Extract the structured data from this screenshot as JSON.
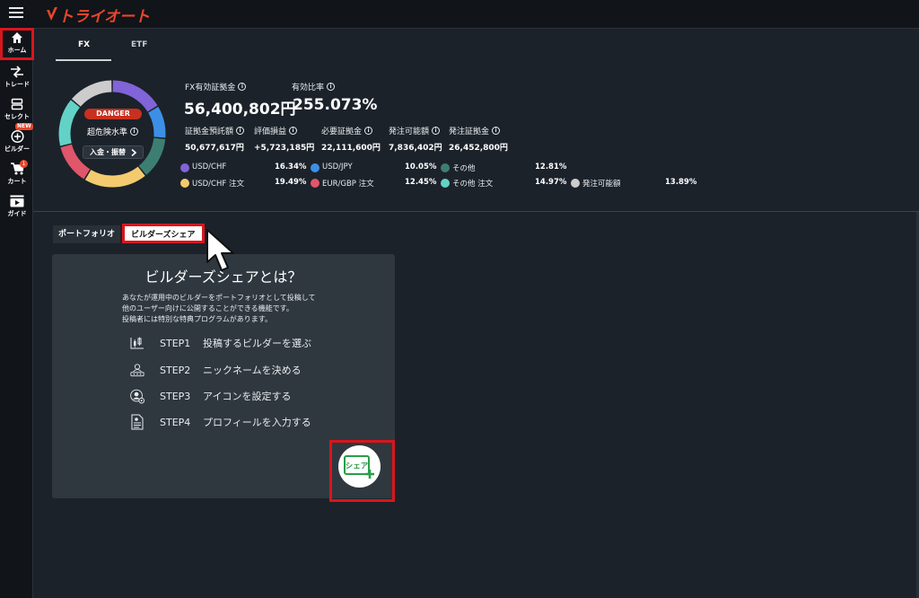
{
  "header": {
    "logo_text": "トライオート",
    "brand_color": "#e8462b"
  },
  "sidebar": {
    "items": [
      {
        "label": "ホーム",
        "icon": "home-icon",
        "active": true
      },
      {
        "label": "トレード",
        "icon": "trade-arrows-icon"
      },
      {
        "label": "セレクト",
        "icon": "select-icon"
      },
      {
        "label": "ビルダー",
        "icon": "builder-plus-icon",
        "badge": "NEW"
      },
      {
        "label": "カート",
        "icon": "cart-icon",
        "count": "1"
      },
      {
        "label": "ガイド",
        "icon": "guide-play-icon"
      }
    ]
  },
  "tabs": {
    "fx": "FX",
    "etf": "ETF",
    "active": "FX"
  },
  "gauge": {
    "badge": "DANGER",
    "level_label": "超危険水準",
    "deposit_button": "入金・振替",
    "danger_color": "#c9301f"
  },
  "summary": {
    "fx_margin_label": "FX有効証拠金",
    "fx_margin_value": "56,400,802円",
    "ratio_label": "有効比率",
    "ratio_value": "255.073%",
    "deposit_label": "証拠金預託額",
    "deposit_value": "50,677,617円",
    "pl_label": "評価損益",
    "pl_value": "+5,723,185円",
    "required_label": "必要証拠金",
    "required_value": "22,111,600円",
    "orderable_label": "発注可能額",
    "orderable_value": "7,836,402円",
    "order_margin_label": "発注証拠金",
    "order_margin_value": "26,452,800円"
  },
  "breakdown": [
    {
      "name": "USD/CHF",
      "pct": "16.34%",
      "color": "#8064d8"
    },
    {
      "name": "USD/JPY",
      "pct": "10.05%",
      "color": "#3d8fe6"
    },
    {
      "name": "その他",
      "pct": "12.81%",
      "color": "#3c7f72"
    },
    {
      "name": "USD/CHF 注文",
      "pct": "19.49%",
      "color": "#f3cb6e"
    },
    {
      "name": "EUR/GBP 注文",
      "pct": "12.45%",
      "color": "#e0566a"
    },
    {
      "name": "その他 注文",
      "pct": "14.97%",
      "color": "#63d2c6"
    },
    {
      "name": "発注可能額",
      "pct": "13.89%",
      "color": "#cccccc"
    }
  ],
  "subtabs": {
    "portfolio": "ポートフォリオ",
    "share": "ビルダーズシェア"
  },
  "card": {
    "title": "ビルダーズシェアとは？",
    "desc": [
      "あなたが運用中のビルダーをポートフォリオとして投稿して",
      "他のユーザー向けに公開することができる機能です。",
      "投稿者には特別な特典プログラムがあります。"
    ],
    "steps": [
      {
        "num": "STEP1",
        "text": "投稿するビルダーを選ぶ",
        "icon": "chart-select-icon"
      },
      {
        "num": "STEP2",
        "text": "ニックネームを決める",
        "icon": "nickname-icon"
      },
      {
        "num": "STEP3",
        "text": "アイコンを設定する",
        "icon": "avatar-settings-icon"
      },
      {
        "num": "STEP4",
        "text": "プロフィールを入力する",
        "icon": "profile-document-icon"
      }
    ],
    "share_button_label": "シェア"
  }
}
